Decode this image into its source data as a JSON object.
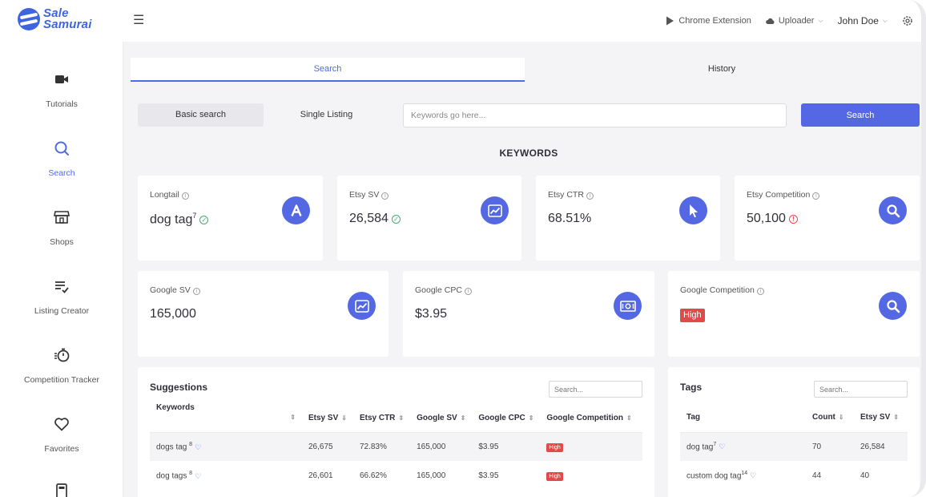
{
  "header": {
    "logo_line1": "Sale",
    "logo_line2": "Samurai",
    "chrome_extension": "Chrome Extension",
    "uploader": "Uploader",
    "user": "John Doe"
  },
  "sidebar": {
    "items": [
      {
        "label": "Tutorials",
        "icon": "video-camera-icon"
      },
      {
        "label": "Search",
        "icon": "search-icon"
      },
      {
        "label": "Shops",
        "icon": "shop-icon"
      },
      {
        "label": "Listing Creator",
        "icon": "list-check-icon"
      },
      {
        "label": "Competition Tracker",
        "icon": "stopwatch-icon"
      },
      {
        "label": "Favorites",
        "icon": "heart-icon"
      }
    ]
  },
  "tabs": {
    "search": "Search",
    "history": "History"
  },
  "search": {
    "basic": "Basic search",
    "single": "Single Listing",
    "placeholder": "Keywords go here...",
    "button": "Search"
  },
  "keywords_heading": "KEYWORDS",
  "cards": {
    "longtail": {
      "label": "Longtail",
      "value": "dog tag",
      "sup": "7"
    },
    "etsy_sv": {
      "label": "Etsy SV",
      "value": "26,584"
    },
    "etsy_ctr": {
      "label": "Etsy CTR",
      "value": "68.51%"
    },
    "etsy_comp": {
      "label": "Etsy Competition",
      "value": "50,100"
    },
    "google_sv": {
      "label": "Google SV",
      "value": "165,000"
    },
    "google_cpc": {
      "label": "Google CPC",
      "value": "$3.95"
    },
    "google_comp": {
      "label": "Google Competition",
      "value": "High"
    }
  },
  "suggestions": {
    "title": "Suggestions",
    "search_placeholder": "Search...",
    "columns": [
      "Keywords",
      "Etsy SV",
      "Etsy CTR",
      "Google SV",
      "Google CPC",
      "Google Competition"
    ],
    "rows": [
      {
        "keyword": "dogs tag",
        "sup": "8",
        "etsy_sv": "26,675",
        "etsy_ctr": "72.83%",
        "google_sv": "165,000",
        "google_cpc": "$3.95",
        "comp": "High"
      },
      {
        "keyword": "dog tags",
        "sup": "8",
        "etsy_sv": "26,601",
        "etsy_ctr": "66.62%",
        "google_sv": "165,000",
        "google_cpc": "$3.95",
        "comp": "High"
      }
    ]
  },
  "tags": {
    "title": "Tags",
    "search_placeholder": "Search...",
    "columns": [
      "Tag",
      "Count",
      "Etsy SV"
    ],
    "rows": [
      {
        "tag": "dog tag",
        "sup": "7",
        "count": "70",
        "etsy_sv": "26,584"
      },
      {
        "tag": "custom dog tag",
        "sup": "14",
        "count": "44",
        "etsy_sv": "40"
      }
    ]
  },
  "colors": {
    "accent": "#5468e3",
    "danger": "#e14a4a",
    "success": "#3db26a"
  }
}
